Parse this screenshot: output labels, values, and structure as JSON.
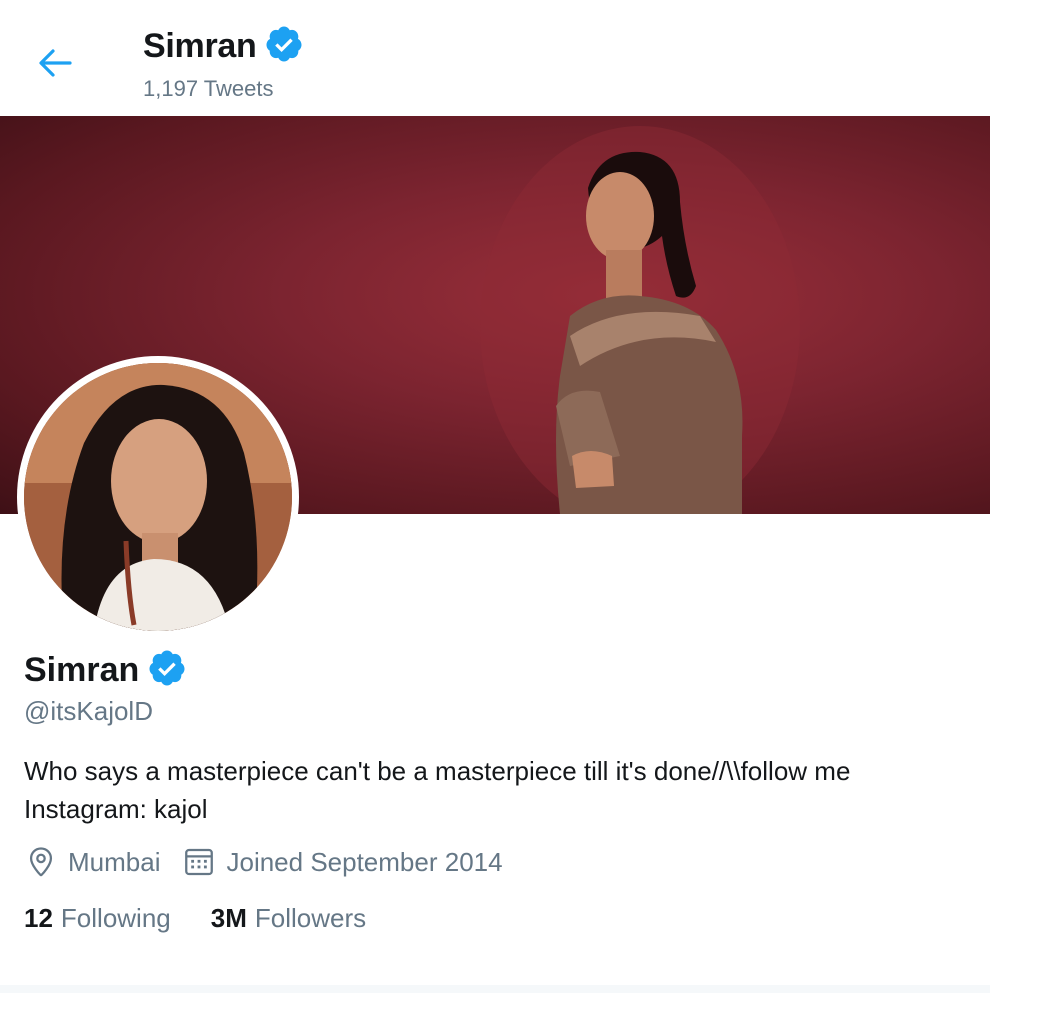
{
  "header": {
    "name": "Simran",
    "tweet_count": "1,197 Tweets"
  },
  "profile": {
    "name": "Simran",
    "handle": "@itsKajolD",
    "bio": "Who says a masterpiece can't be a masterpiece till it's done//\\\\follow me\nInstagram: kajol",
    "location": "Mumbai",
    "joined": "Joined September 2014",
    "following_count": "12",
    "following_label": "Following",
    "followers_count": "3M",
    "followers_label": "Followers"
  },
  "icons": {
    "back": "back-arrow-icon",
    "verified": "verified-badge-icon",
    "location": "location-pin-icon",
    "calendar": "calendar-icon"
  },
  "colors": {
    "accent": "#1da1f2",
    "text": "#14171a",
    "secondary_text": "#657786",
    "banner": "#7c2430"
  }
}
